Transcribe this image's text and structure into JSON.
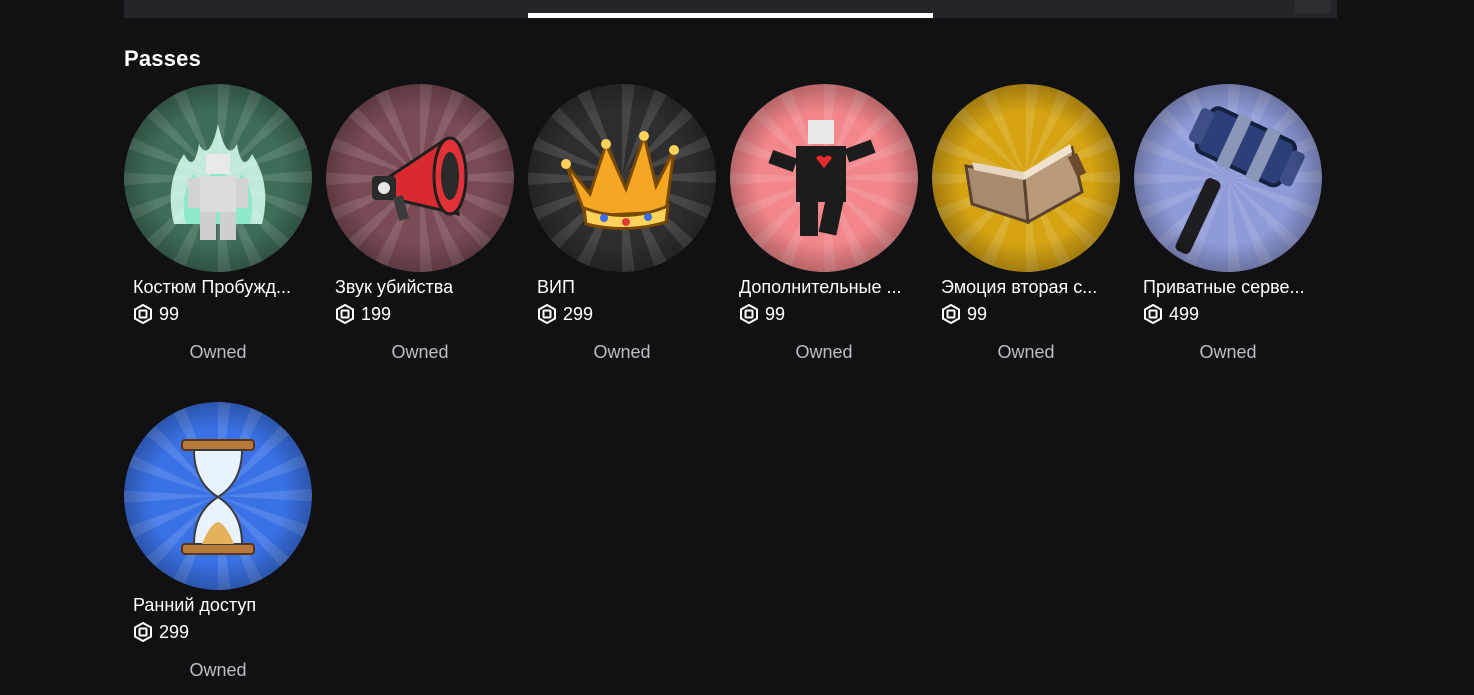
{
  "section": {
    "title": "Passes"
  },
  "passes": [
    {
      "name": "Костюм Пробужд...",
      "price": "99",
      "status": "Owned",
      "icon": "awakening-aura-figure-icon",
      "color": "#3f6d59"
    },
    {
      "name": "Звук убийства",
      "price": "199",
      "status": "Owned",
      "icon": "megaphone-icon",
      "color": "#7b4b55"
    },
    {
      "name": "ВИП",
      "price": "299",
      "status": "Owned",
      "icon": "crown-icon",
      "color": "#2e2e30"
    },
    {
      "name": "Дополнительные ...",
      "price": "99",
      "status": "Owned",
      "icon": "emote-slots-character-icon",
      "color": "#f2868a"
    },
    {
      "name": "Эмоция вторая с...",
      "price": "99",
      "status": "Owned",
      "icon": "open-book-icon",
      "color": "#d6a413"
    },
    {
      "name": "Приватные серве...",
      "price": "499",
      "status": "Owned",
      "icon": "hammer-icon",
      "color": "#8f9ad8"
    },
    {
      "name": "Ранний доступ",
      "price": "299",
      "status": "Owned",
      "icon": "early-access-hourglass-icon",
      "color": "#3a72e6"
    }
  ]
}
